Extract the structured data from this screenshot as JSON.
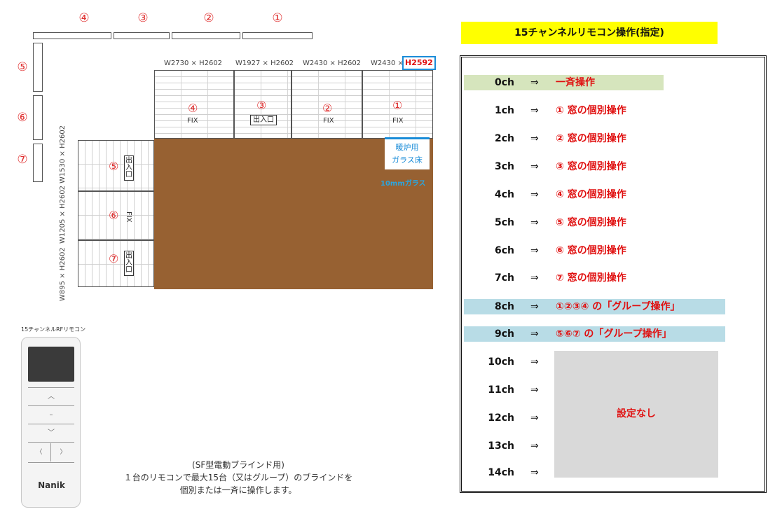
{
  "top_numbers": [
    "④",
    "③",
    "②",
    "①"
  ],
  "side_numbers": [
    "⑤",
    "⑥",
    "⑦"
  ],
  "dims_top": [
    "W2730 × H2602",
    "W1927 × H2602",
    "W2430 × H2602",
    "W2430 ×"
  ],
  "dim_highlight": "H2592",
  "dims_side": [
    "W1530 × H2602",
    "W1205 × H2602",
    "W895 × H2602"
  ],
  "windows_top": [
    {
      "num": "④",
      "fix": "FIX",
      "door": ""
    },
    {
      "num": "③",
      "fix": "",
      "door": "出入口"
    },
    {
      "num": "②",
      "fix": "FIX",
      "door": ""
    },
    {
      "num": "①",
      "fix": "FIX",
      "door": ""
    }
  ],
  "windows_side": [
    {
      "num": "⑤",
      "fix": "",
      "door": "出入口"
    },
    {
      "num": "⑥",
      "fix": "FIX",
      "door": ""
    },
    {
      "num": "⑦",
      "fix": "",
      "door": "出入口"
    }
  ],
  "stove": {
    "line1": "暖炉用",
    "line2": "ガラス床",
    "glass": "10mmガラス"
  },
  "remote_caption": "15チャンネルRFリモコン",
  "remote_brand": "Nanik",
  "remote_buttons": {
    "up": "︿",
    "stop": "–",
    "down": "﹀",
    "left": "〈",
    "right": "〉"
  },
  "note_lines": [
    "(SF型電動ブラインド用)",
    "１台のリモコンで最大15台（又はグループ）のブラインドを",
    "個別または一斉に操作します。"
  ],
  "panel_title": "15チャンネルリモコン操作(指定)",
  "arrow": "⇒",
  "channels": [
    {
      "ch": "0ch",
      "desc": "一斉操作",
      "highlight": "#d6e5bd"
    },
    {
      "ch": "1ch",
      "desc": "①  窓の個別操作",
      "highlight": ""
    },
    {
      "ch": "2ch",
      "desc": "②  窓の個別操作",
      "highlight": ""
    },
    {
      "ch": "3ch",
      "desc": "③  窓の個別操作",
      "highlight": ""
    },
    {
      "ch": "4ch",
      "desc": "④  窓の個別操作",
      "highlight": ""
    },
    {
      "ch": "5ch",
      "desc": "⑤  窓の個別操作",
      "highlight": ""
    },
    {
      "ch": "6ch",
      "desc": "⑥  窓の個別操作",
      "highlight": ""
    },
    {
      "ch": "7ch",
      "desc": "⑦  窓の個別操作",
      "highlight": ""
    },
    {
      "ch": "8ch",
      "desc": "①②③④  の「グループ操作」",
      "highlight": "#b8dce6"
    },
    {
      "ch": "9ch",
      "desc": "⑤⑥⑦  の「グループ操作」",
      "highlight": "#b8dce6"
    },
    {
      "ch": "10ch",
      "desc": "",
      "highlight": ""
    },
    {
      "ch": "11ch",
      "desc": "",
      "highlight": ""
    },
    {
      "ch": "12ch",
      "desc": "",
      "highlight": ""
    },
    {
      "ch": "13ch",
      "desc": "",
      "highlight": ""
    },
    {
      "ch": "14ch",
      "desc": "",
      "highlight": ""
    }
  ],
  "no_setting": "設定なし",
  "colors": {
    "red": "#e01010",
    "floor": "#976132",
    "title_bg": "#ffff00",
    "green_row": "#d6e5bd",
    "blue_row": "#b8dce6",
    "no_setting_bg": "#d9d9d9"
  }
}
